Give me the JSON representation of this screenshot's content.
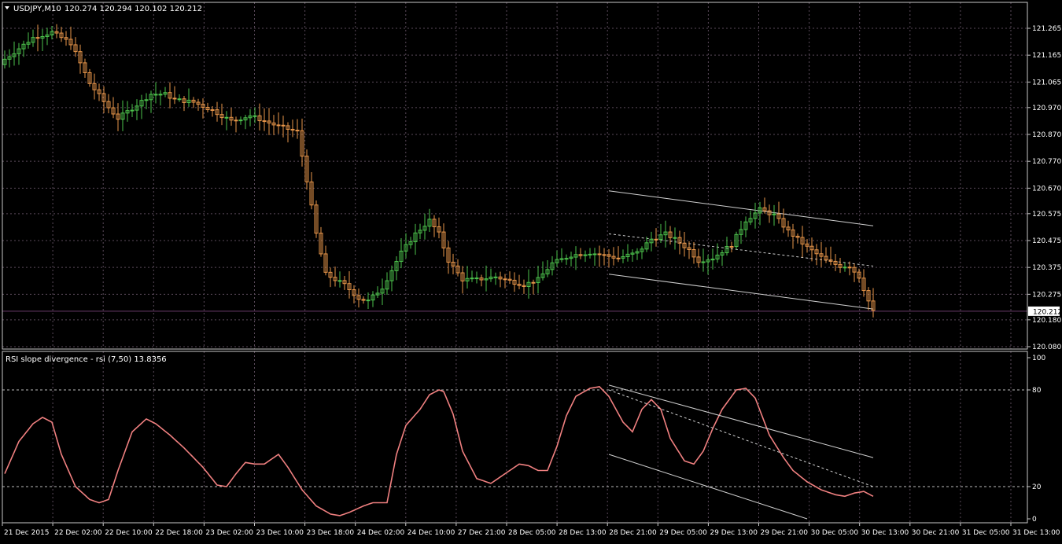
{
  "header": {
    "symbol_tf": "USDJPY,M10",
    "ohlc": "120.274 120.294 120.102 120.212"
  },
  "indicator": {
    "label": "RSI slope divergence - rsi (7,50) 13.8356"
  },
  "colors": {
    "background": "#000000",
    "grid": "#5a4a5a",
    "axis_frame": "#c8c8c8",
    "bull_candle": "#4cc24c",
    "bear_candle": "#e8964a",
    "rsi_line": "#f08080",
    "channel": "#cfcfcf",
    "price_line": "#6a3a6a"
  },
  "chart_data": [
    {
      "type": "candlestick",
      "title": "USDJPY,M10",
      "ylim": [
        120.05,
        121.32
      ],
      "y_ticks": [
        "121.265",
        "121.165",
        "121.065",
        "120.970",
        "120.870",
        "120.770",
        "120.670",
        "120.575",
        "120.475",
        "120.375",
        "120.275",
        "120.180",
        "120.080"
      ],
      "y_tick_values": [
        121.265,
        121.165,
        121.065,
        120.97,
        120.87,
        120.77,
        120.67,
        120.575,
        120.475,
        120.375,
        120.275,
        120.18,
        120.08
      ],
      "current_price_label": "120.212",
      "current_price": 120.212,
      "x_ticks": [
        "21 Dec 2015",
        "22 Dec 02:00",
        "22 Dec 10:00",
        "22 Dec 18:00",
        "23 Dec 02:00",
        "23 Dec 10:00",
        "23 Dec 18:00",
        "24 Dec 02:00",
        "24 Dec 10:00",
        "27 Dec 21:00",
        "28 Dec 05:00",
        "28 Dec 13:00",
        "28 Dec 21:00",
        "29 Dec 05:00",
        "29 Dec 13:00",
        "29 Dec 21:00",
        "30 Dec 05:00",
        "30 Dec 13:00",
        "30 Dec 21:00",
        "31 Dec 05:00",
        "31 Dec 13:00"
      ],
      "close_path": [
        [
          0,
          121.15
        ],
        [
          6,
          121.23
        ],
        [
          10,
          121.25
        ],
        [
          14,
          121.21
        ],
        [
          18,
          121.06
        ],
        [
          22,
          120.97
        ],
        [
          24,
          120.93
        ],
        [
          28,
          120.98
        ],
        [
          31,
          121.02
        ],
        [
          34,
          121.02
        ],
        [
          36,
          121.0
        ],
        [
          40,
          120.99
        ],
        [
          44,
          120.96
        ],
        [
          48,
          120.92
        ],
        [
          52,
          120.94
        ],
        [
          55,
          120.92
        ],
        [
          58,
          120.9
        ],
        [
          62,
          120.88
        ],
        [
          64,
          120.7
        ],
        [
          66,
          120.5
        ],
        [
          68,
          120.35
        ],
        [
          70,
          120.33
        ],
        [
          72,
          120.31
        ],
        [
          75,
          120.26
        ],
        [
          77,
          120.25
        ],
        [
          80,
          120.3
        ],
        [
          84,
          120.43
        ],
        [
          87,
          120.5
        ],
        [
          90,
          120.55
        ],
        [
          92,
          120.5
        ],
        [
          94,
          120.4
        ],
        [
          97,
          120.33
        ],
        [
          100,
          120.33
        ],
        [
          104,
          120.34
        ],
        [
          106,
          120.33
        ],
        [
          110,
          120.31
        ],
        [
          113,
          120.33
        ],
        [
          116,
          120.39
        ],
        [
          120,
          120.42
        ],
        [
          124,
          120.43
        ],
        [
          127,
          120.42
        ],
        [
          130,
          120.41
        ],
        [
          134,
          120.43
        ],
        [
          137,
          120.48
        ],
        [
          140,
          120.5
        ],
        [
          142,
          120.48
        ],
        [
          145,
          120.44
        ],
        [
          147,
          120.4
        ],
        [
          150,
          120.41
        ],
        [
          154,
          120.46
        ],
        [
          157,
          120.55
        ],
        [
          160,
          120.59
        ],
        [
          163,
          120.57
        ],
        [
          166,
          120.51
        ],
        [
          170,
          120.45
        ],
        [
          174,
          120.4
        ],
        [
          177,
          120.38
        ],
        [
          179,
          120.38
        ],
        [
          181,
          120.34
        ],
        [
          183,
          120.25
        ],
        [
          184,
          120.21
        ]
      ],
      "channel_lines": [
        {
          "from": [
            128,
            120.66
          ],
          "to": [
            184,
            120.53
          ]
        },
        {
          "from": [
            128,
            120.5
          ],
          "to": [
            184,
            120.38
          ]
        },
        {
          "from": [
            128,
            120.35
          ],
          "to": [
            184,
            120.22
          ]
        }
      ]
    },
    {
      "type": "line",
      "title": "RSI slope divergence - rsi (7,50) 13.8356",
      "ylim": [
        0,
        100
      ],
      "y_ticks": [
        "100",
        "80",
        "20",
        "0"
      ],
      "y_tick_values": [
        100,
        80,
        20,
        0
      ],
      "levels": [
        80,
        20
      ],
      "rsi_path": [
        [
          0,
          28
        ],
        [
          3,
          48
        ],
        [
          6,
          59
        ],
        [
          8,
          63
        ],
        [
          10,
          60
        ],
        [
          12,
          40
        ],
        [
          15,
          20
        ],
        [
          18,
          12
        ],
        [
          20,
          10
        ],
        [
          22,
          12
        ],
        [
          24,
          30
        ],
        [
          27,
          54
        ],
        [
          30,
          62
        ],
        [
          32,
          59
        ],
        [
          35,
          52
        ],
        [
          38,
          44
        ],
        [
          42,
          32
        ],
        [
          45,
          21
        ],
        [
          47,
          20
        ],
        [
          49,
          28
        ],
        [
          51,
          35
        ],
        [
          53,
          34
        ],
        [
          55,
          34
        ],
        [
          57,
          38
        ],
        [
          58,
          40
        ],
        [
          60,
          32
        ],
        [
          63,
          18
        ],
        [
          66,
          8
        ],
        [
          69,
          3
        ],
        [
          71,
          2
        ],
        [
          73,
          4
        ],
        [
          76,
          8
        ],
        [
          78,
          10
        ],
        [
          80,
          10
        ],
        [
          81,
          10
        ],
        [
          83,
          40
        ],
        [
          85,
          58
        ],
        [
          88,
          68
        ],
        [
          90,
          77
        ],
        [
          92,
          80
        ],
        [
          93,
          79
        ],
        [
          95,
          65
        ],
        [
          97,
          42
        ],
        [
          100,
          25
        ],
        [
          103,
          22
        ],
        [
          106,
          28
        ],
        [
          109,
          34
        ],
        [
          111,
          33
        ],
        [
          113,
          30
        ],
        [
          115,
          30
        ],
        [
          117,
          45
        ],
        [
          119,
          64
        ],
        [
          121,
          76
        ],
        [
          124,
          81
        ],
        [
          126,
          82
        ],
        [
          128,
          76
        ],
        [
          131,
          60
        ],
        [
          133,
          54
        ],
        [
          135,
          68
        ],
        [
          137,
          74
        ],
        [
          139,
          68
        ],
        [
          141,
          50
        ],
        [
          144,
          36
        ],
        [
          146,
          34
        ],
        [
          148,
          42
        ],
        [
          150,
          56
        ],
        [
          152,
          68
        ],
        [
          155,
          80
        ],
        [
          157,
          81
        ],
        [
          159,
          75
        ],
        [
          162,
          52
        ],
        [
          165,
          38
        ],
        [
          167,
          30
        ],
        [
          170,
          23
        ],
        [
          173,
          18
        ],
        [
          176,
          15
        ],
        [
          178,
          14
        ],
        [
          180,
          16
        ],
        [
          182,
          17
        ],
        [
          184,
          14
        ]
      ],
      "channel_lines": [
        {
          "from": [
            128,
            83
          ],
          "to": [
            184,
            38
          ]
        },
        {
          "from": [
            128,
            80
          ],
          "to": [
            184,
            20
          ]
        },
        {
          "from": [
            128,
            40
          ],
          "to": [
            170,
            0
          ]
        }
      ]
    }
  ]
}
